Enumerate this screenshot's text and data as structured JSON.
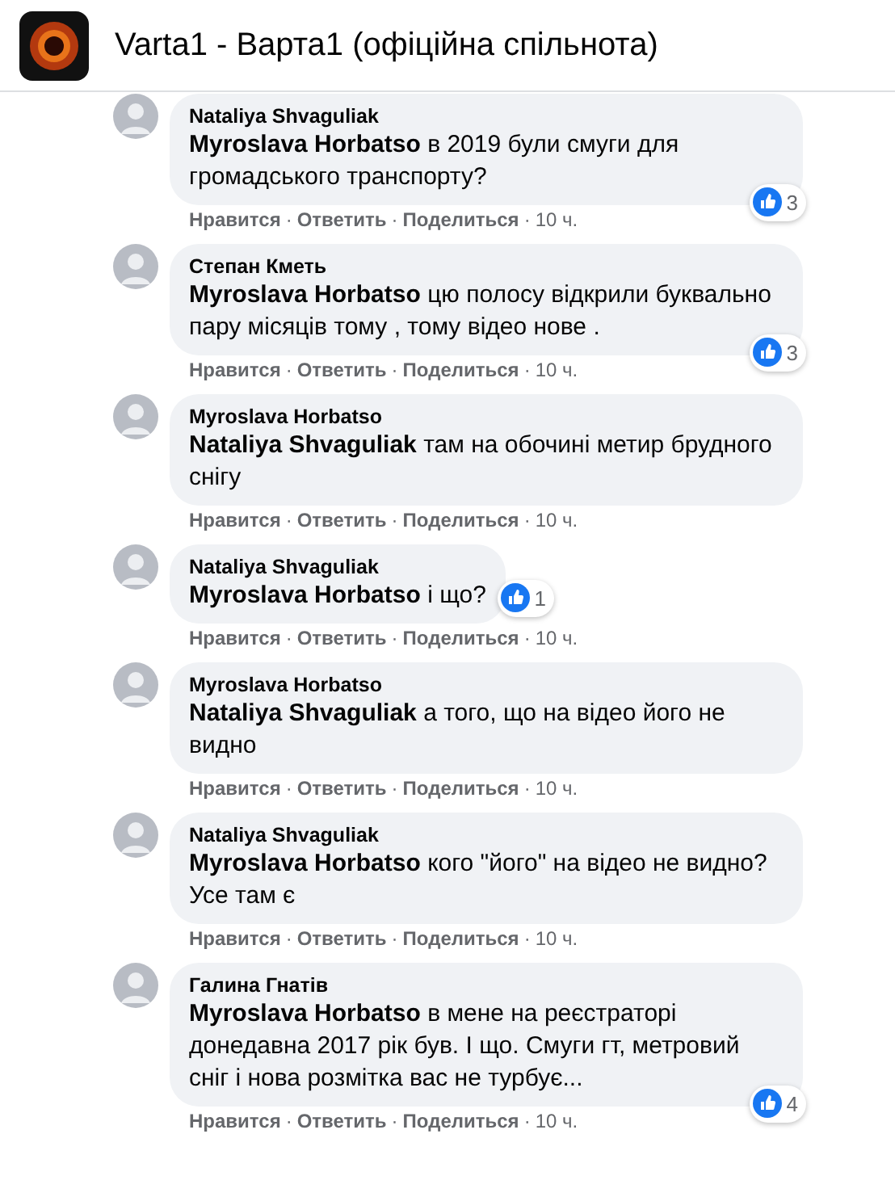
{
  "header": {
    "title": "Varta1 - Варта1 (офіційна спільнота)"
  },
  "comments": [
    {
      "author": "Nataliya Shvaguliak",
      "mention": "Myroslava Horbatso",
      "text": "в 2019 були смуги для громадського транспорту?",
      "actions": [
        {
          "label": "Нравится",
          "sep": "·"
        },
        {
          "label": "Ответить",
          "sep": "·"
        },
        {
          "label": "Поделиться",
          "sep": "·"
        }
      ],
      "time": "10 ч.",
      "likes": "3"
    },
    {
      "author": "Степан Кметь",
      "mention": "Myroslava Horbatso",
      "text": "цю полосу відкрили буквально пару місяців тому , тому відео нове .",
      "actions": [
        {
          "label": "Нравится",
          "sep": "·"
        },
        {
          "label": "Ответить",
          "sep": "·"
        },
        {
          "label": "Поделиться",
          "sep": "·"
        }
      ],
      "time": "10 ч.",
      "likes": "3"
    },
    {
      "author": "Myroslava Horbatso",
      "mention": "Nataliya Shvaguliak",
      "text": "там на обочині метир брудного снігу",
      "actions": [
        {
          "label": "Нравится",
          "sep": "·"
        },
        {
          "label": "Ответить",
          "sep": "·"
        },
        {
          "label": "Поделиться",
          "sep": "·"
        }
      ],
      "time": "10 ч."
    },
    {
      "author": "Nataliya Shvaguliak",
      "mention": "Myroslava Horbatso",
      "text": "і що?",
      "actions": [
        {
          "label": "Нравится",
          "sep": "·"
        },
        {
          "label": "Ответить",
          "sep": "·"
        },
        {
          "label": "Поделиться",
          "sep": "·"
        }
      ],
      "time": "10 ч.",
      "likes": "1"
    },
    {
      "author": "Myroslava Horbatso",
      "mention": "Nataliya Shvaguliak",
      "text": "а того, що на відео його не видно",
      "actions": [
        {
          "label": "Нравится",
          "sep": "·"
        },
        {
          "label": "Ответить",
          "sep": "·"
        },
        {
          "label": "Поделиться",
          "sep": "·"
        }
      ],
      "time": "10 ч."
    },
    {
      "author": "Nataliya Shvaguliak",
      "mention": "Myroslava Horbatso",
      "text": "кого \"його\" на відео не видно? Усе там є",
      "actions": [
        {
          "label": "Нравится",
          "sep": "·"
        },
        {
          "label": "Ответить",
          "sep": "·"
        },
        {
          "label": "Поделиться",
          "sep": "·"
        }
      ],
      "time": "10 ч."
    },
    {
      "author": "Галина Гнатів",
      "mention": "Myroslava Horbatso",
      "text": "в мене на реєстраторі донедавна 2017 рік був. І що. Смуги гт, метровий сніг і нова розмітка вас не турбує...",
      "actions": [
        {
          "label": "Нравится",
          "sep": "·"
        },
        {
          "label": "Ответить",
          "sep": "·"
        },
        {
          "label": "Поделиться",
          "sep": "·"
        }
      ],
      "time": "10 ч.",
      "likes": "4"
    }
  ]
}
